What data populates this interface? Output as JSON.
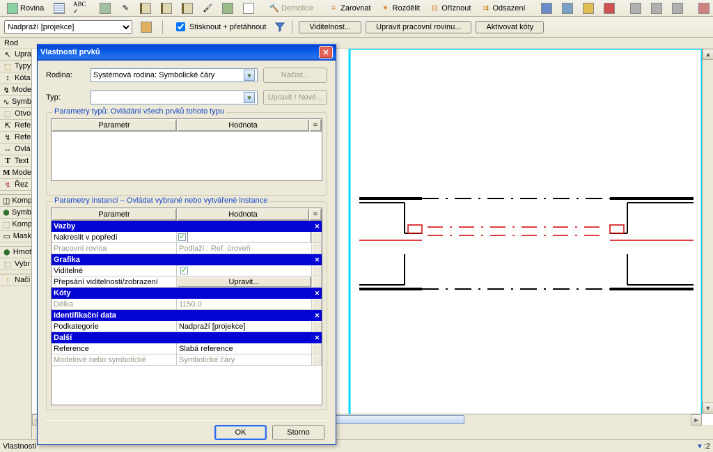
{
  "toolbar": {
    "rovina": "Rovina",
    "demolice": "Demolice",
    "zarovnat": "Zarovnat",
    "rozdelit": "Rozdělit",
    "oriznout": "Oříznout",
    "odsazeni": "Odsazení"
  },
  "toolbar2": {
    "dropdown_value": "Nadpraží [projekce]",
    "stisknout": "Stisknout + přetáhnout",
    "viditelnost": "Viditelnost...",
    "upravit_rovinu": "Upravit pracovní rovinu...",
    "aktivovat_koty": "Aktivovat kóty"
  },
  "sidetabs": {
    "rod": "Rod",
    "upra": "Upra",
    "typy": "Typy",
    "kota": "Kóta",
    "mode1": "Mode",
    "symb": "Symb",
    "otvo": "Otvo",
    "refe1": "Refe",
    "refe2": "Refe",
    "ovla": "Ovlá",
    "text": "Text",
    "mode2": "Mode",
    "rez": "Řez",
    "komp1": "Komp",
    "symb2": "Symb",
    "komp2": "Komp",
    "mask": "Mask",
    "hmot": "Hmot",
    "vybr": "Vybr",
    "naci": "Načí"
  },
  "dialog": {
    "title": "Vlastnosti prvků",
    "rodina_label": "Rodina:",
    "rodina_value": "Systémová rodina: Symbolické čáry",
    "nacist_btn": "Načíst...",
    "typ_label": "Typ:",
    "typ_value": "",
    "upravit_nove_btn": "Upravit / Nové...",
    "group1_label": "Parametry typů: Ovládání všech prvků tohoto typu",
    "col_param": "Parametr",
    "col_hodnota": "Hodnota",
    "eq": "=",
    "group2_label": "Parametry instancí – Ovládat vybrané nebo vytvářené instance",
    "cat_vazby": "Vazby",
    "p_nakreslit": "Nakreslit v popředí",
    "p_prac_rovina": "Pracovní rovina",
    "v_prac_rovina": "Podlaží : Ref. úroveň",
    "cat_grafika": "Grafika",
    "p_viditelne": "Viditelné",
    "p_prepsani": "Přepsání viditelnosti/zobrazení",
    "v_upravit": "Upravit...",
    "cat_koty": "Kóty",
    "p_delka": "Délka",
    "v_delka": "1150.0",
    "cat_ident": "Identifikační data",
    "p_podkat": "Podkategorie",
    "v_podkat": "Nadpraží [projekce]",
    "cat_dalsi": "Další",
    "p_reference": "Reference",
    "v_reference": "Slabá reference",
    "p_modelove": "Modelové nebo symbolické",
    "v_modelove": "Symbolické čáry",
    "ok": "OK",
    "storno": "Storno"
  },
  "status": {
    "vlastnosti": "Vlastnosti",
    "corner": ":2"
  }
}
